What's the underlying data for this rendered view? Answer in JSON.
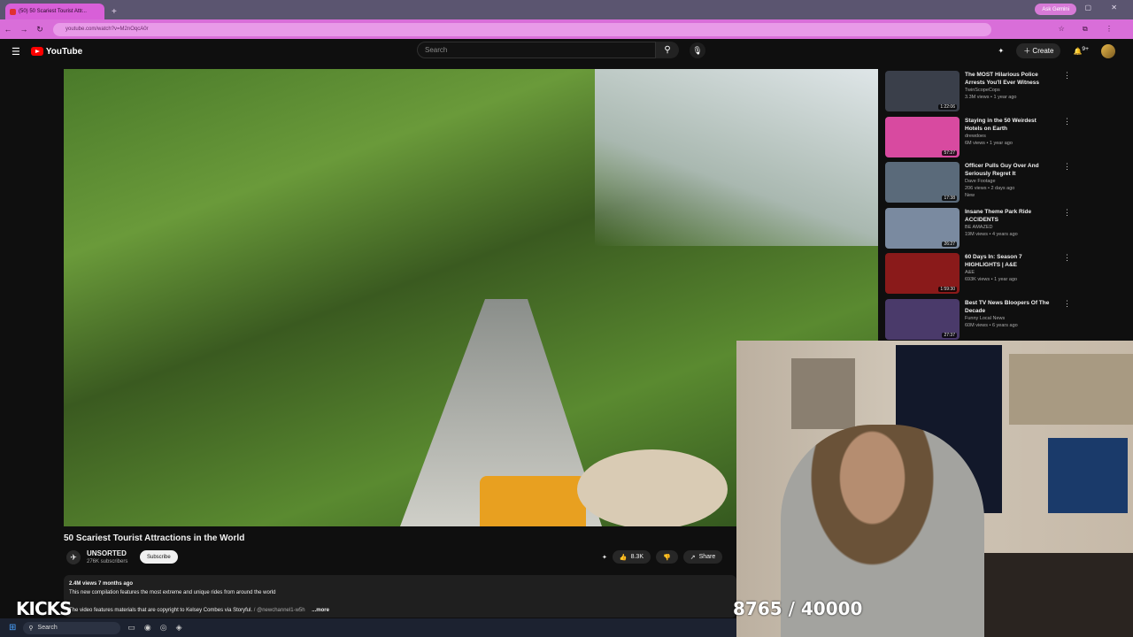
{
  "browser": {
    "tab_title": "(50) 50 Scariest Tourist Attr...",
    "new_tab_icon": "+",
    "ask_gemini": "Ask Gemini",
    "url": "youtube.com/watch?v=M2nOqcA0r",
    "window_controls": "— ▢ ✕"
  },
  "youtube": {
    "logo_text": "YouTube",
    "search_placeholder": "Search",
    "create_label": "Create",
    "notifications_badge": "9+"
  },
  "video": {
    "title": "50 Scariest Tourist Attractions in the World",
    "channel": "UNSORTED",
    "subscribers": "276K subscribers",
    "subscribe_label": "Subscribe",
    "likes": "8.3K",
    "share_label": "Share",
    "description_meta": "2.4M views  7 months ago",
    "description_line1": "This new compilation features the most extreme and unique rides from around the world",
    "description_line2": "The video features materials that are copyright to Kelsey Combes via Storyful.",
    "description_link": "/ @newchannel1-w5h",
    "more_label": "...more"
  },
  "related": [
    {
      "title": "The MOST Hilarious Police Arrests You'll Ever Witness",
      "channel": "TwinScopeCops",
      "stats": "3.3M views • 1 year ago",
      "duration": "1:22:06",
      "badge": "",
      "color": "#3a3f4a"
    },
    {
      "title": "Staying in the 50 Weirdest Hotels on Earth",
      "channel": "drewdoes",
      "stats": "6M views • 1 year ago",
      "duration": "57:27",
      "badge": "",
      "color": "#d84aa0"
    },
    {
      "title": "Officer Pulls Guy Over And Seriously Regret It",
      "channel": "Dave Footage",
      "stats": "206 views • 2 days ago",
      "duration": "17:38",
      "badge": "New",
      "color": "#5a6a7a"
    },
    {
      "title": "Insane Theme Park Ride ACCIDENTS",
      "channel": "BE AMAZED",
      "stats": "19M views • 4 years ago",
      "duration": "26:27",
      "badge": "",
      "color": "#7a8aa0"
    },
    {
      "title": "60 Days In: Season 7 HIGHLIGHTS | A&E",
      "channel": "A&E",
      "stats": "693K views • 1 year ago",
      "duration": "1:59:30",
      "badge": "",
      "color": "#8a1a1a"
    },
    {
      "title": "Best TV News Bloopers Of The Decade",
      "channel": "Funny Local News",
      "stats": "60M views • 6 years ago",
      "duration": "27:37",
      "badge": "",
      "color": "#4a3a6a"
    }
  ],
  "overlay": {
    "kicks_label": "KICKS",
    "counter": "8765 / 40000"
  },
  "taskbar": {
    "search_label": "Search"
  }
}
